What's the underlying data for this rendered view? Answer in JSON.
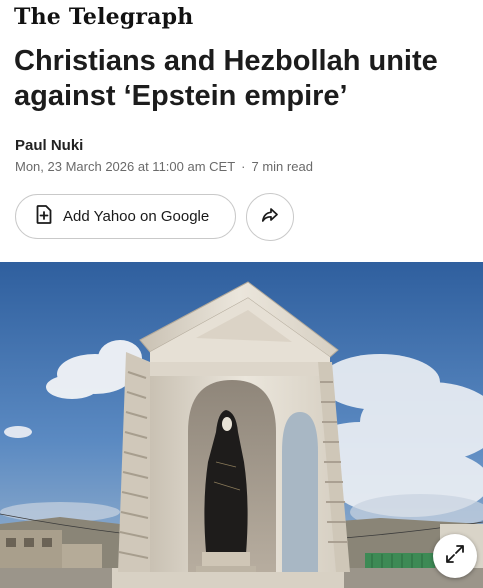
{
  "masthead": {
    "logo_text": "The Telegraph"
  },
  "article": {
    "headline": "Christians and Hezbollah unite against ‘Epstein empire’",
    "author": "Paul Nuki",
    "date": "Mon, 23 March 2026 at 11:00 am CET",
    "separator": "·",
    "read_time": "7 min read"
  },
  "actions": {
    "yahoo_google_label": "Add Yahoo on Google",
    "yahoo_google_icon": "add-document-icon",
    "share_icon": "share-arrow-icon"
  },
  "hero": {
    "description_icon": "expand-icon",
    "colors": {
      "sky": "#3f76b8",
      "shrine": "#e3ddd1",
      "figure": "#1a1918"
    }
  }
}
